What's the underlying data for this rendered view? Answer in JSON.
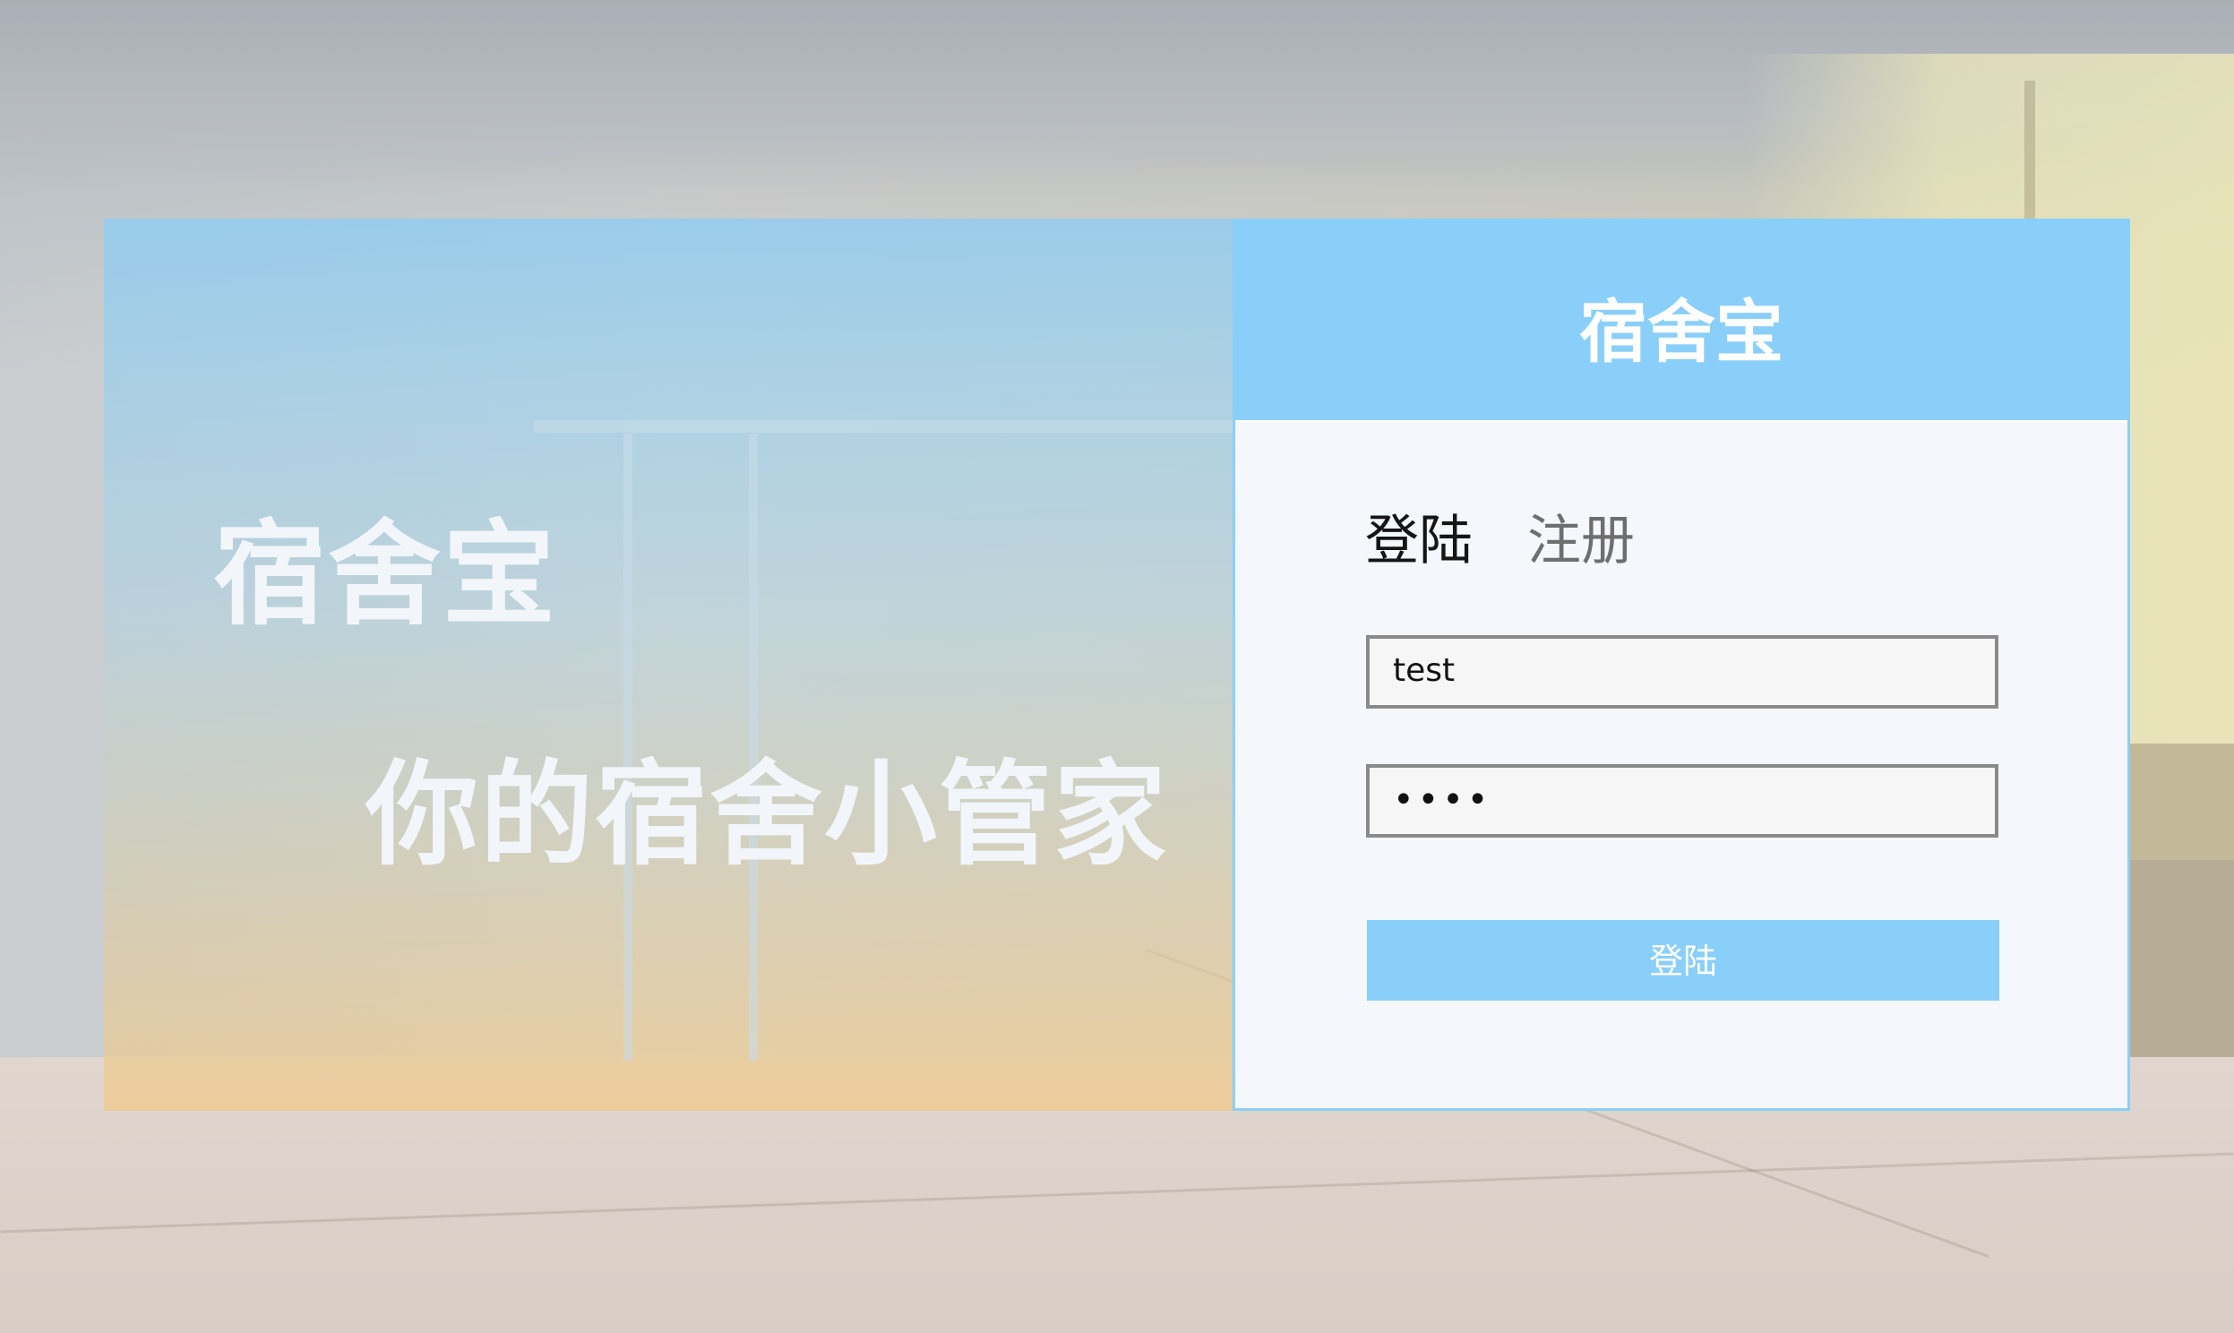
{
  "app": {
    "brand_name": "宿舍宝",
    "tagline": "你的宿舍小管家"
  },
  "login_card": {
    "title": "宿舍宝",
    "tabs": [
      {
        "label": "登陆",
        "active": true
      },
      {
        "label": "注册",
        "active": false
      }
    ],
    "username": {
      "value": "test"
    },
    "password": {
      "value": "••••",
      "masked": true
    },
    "submit_label": "登陆"
  },
  "colors": {
    "accent": "#8acff9",
    "card_bg": "#f4f7fb",
    "field_border": "#8a8a8a",
    "active_tab": "#151515",
    "inactive_tab": "#6e6e6e"
  }
}
